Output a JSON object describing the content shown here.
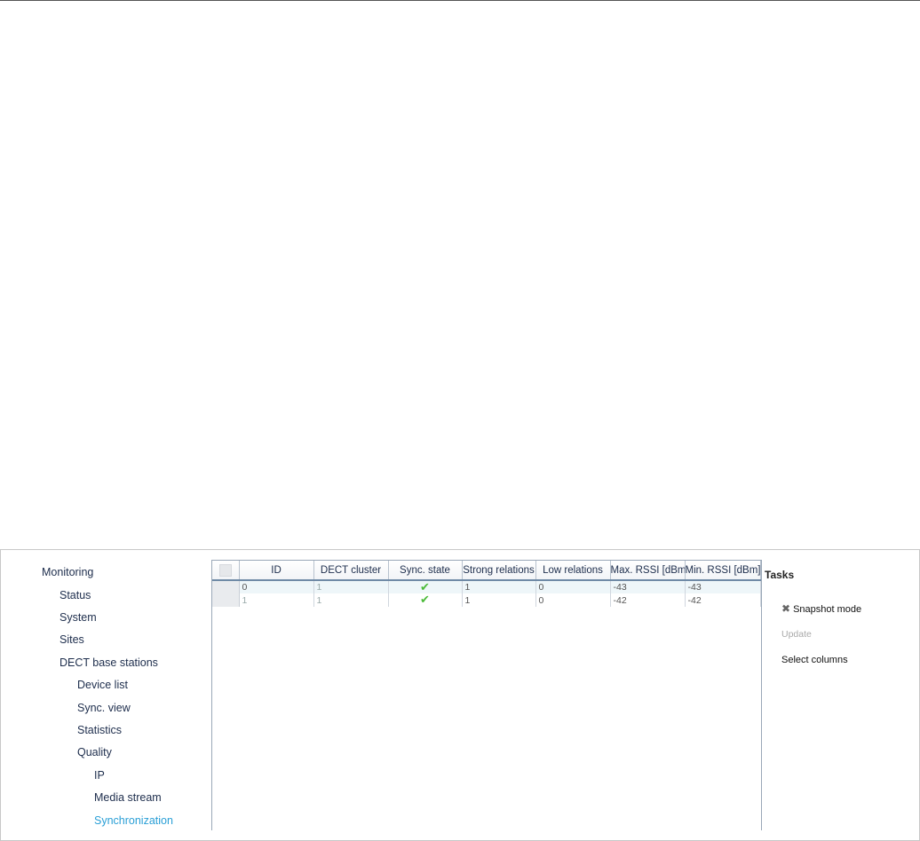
{
  "nav": {
    "items": [
      {
        "label": "Monitoring",
        "level": 0,
        "active": false
      },
      {
        "label": "Status",
        "level": 1,
        "active": false
      },
      {
        "label": "System",
        "level": 1,
        "active": false
      },
      {
        "label": "Sites",
        "level": 1,
        "active": false
      },
      {
        "label": "DECT base stations",
        "level": 1,
        "active": false
      },
      {
        "label": "Device list",
        "level": 2,
        "active": false
      },
      {
        "label": "Sync. view",
        "level": 2,
        "active": false
      },
      {
        "label": "Statistics",
        "level": 2,
        "active": false
      },
      {
        "label": "Quality",
        "level": 2,
        "active": false
      },
      {
        "label": "IP",
        "level": 3,
        "active": false
      },
      {
        "label": "Media stream",
        "level": 3,
        "active": false
      },
      {
        "label": "Synchronization",
        "level": 3,
        "active": true
      }
    ]
  },
  "grid": {
    "columns": [
      "ID",
      "DECT cluster",
      "Sync. state",
      "Strong relations",
      "Low relations",
      "Max. RSSI [dBm]",
      "Min. RSSI [dBm]"
    ],
    "rows": [
      {
        "id": "0",
        "cluster": "1",
        "sync": "check-icon",
        "strong": "1",
        "low": "0",
        "max_rssi": "-43",
        "min_rssi": "-43"
      },
      {
        "id": "1",
        "cluster": "1",
        "sync": "check-icon",
        "strong": "1",
        "low": "0",
        "max_rssi": "-42",
        "min_rssi": "-42"
      }
    ]
  },
  "tasks": {
    "title": "Tasks",
    "snapshot_label": "Snapshot mode",
    "snapshot_icon": "close-icon",
    "update_label": "Update",
    "select_columns_label": "Select columns"
  },
  "colors": {
    "active_nav": "#2a9fd6",
    "nav_text": "#1d2d4c",
    "check": "#4cbb3a",
    "row_alt": "#eef6f9"
  }
}
